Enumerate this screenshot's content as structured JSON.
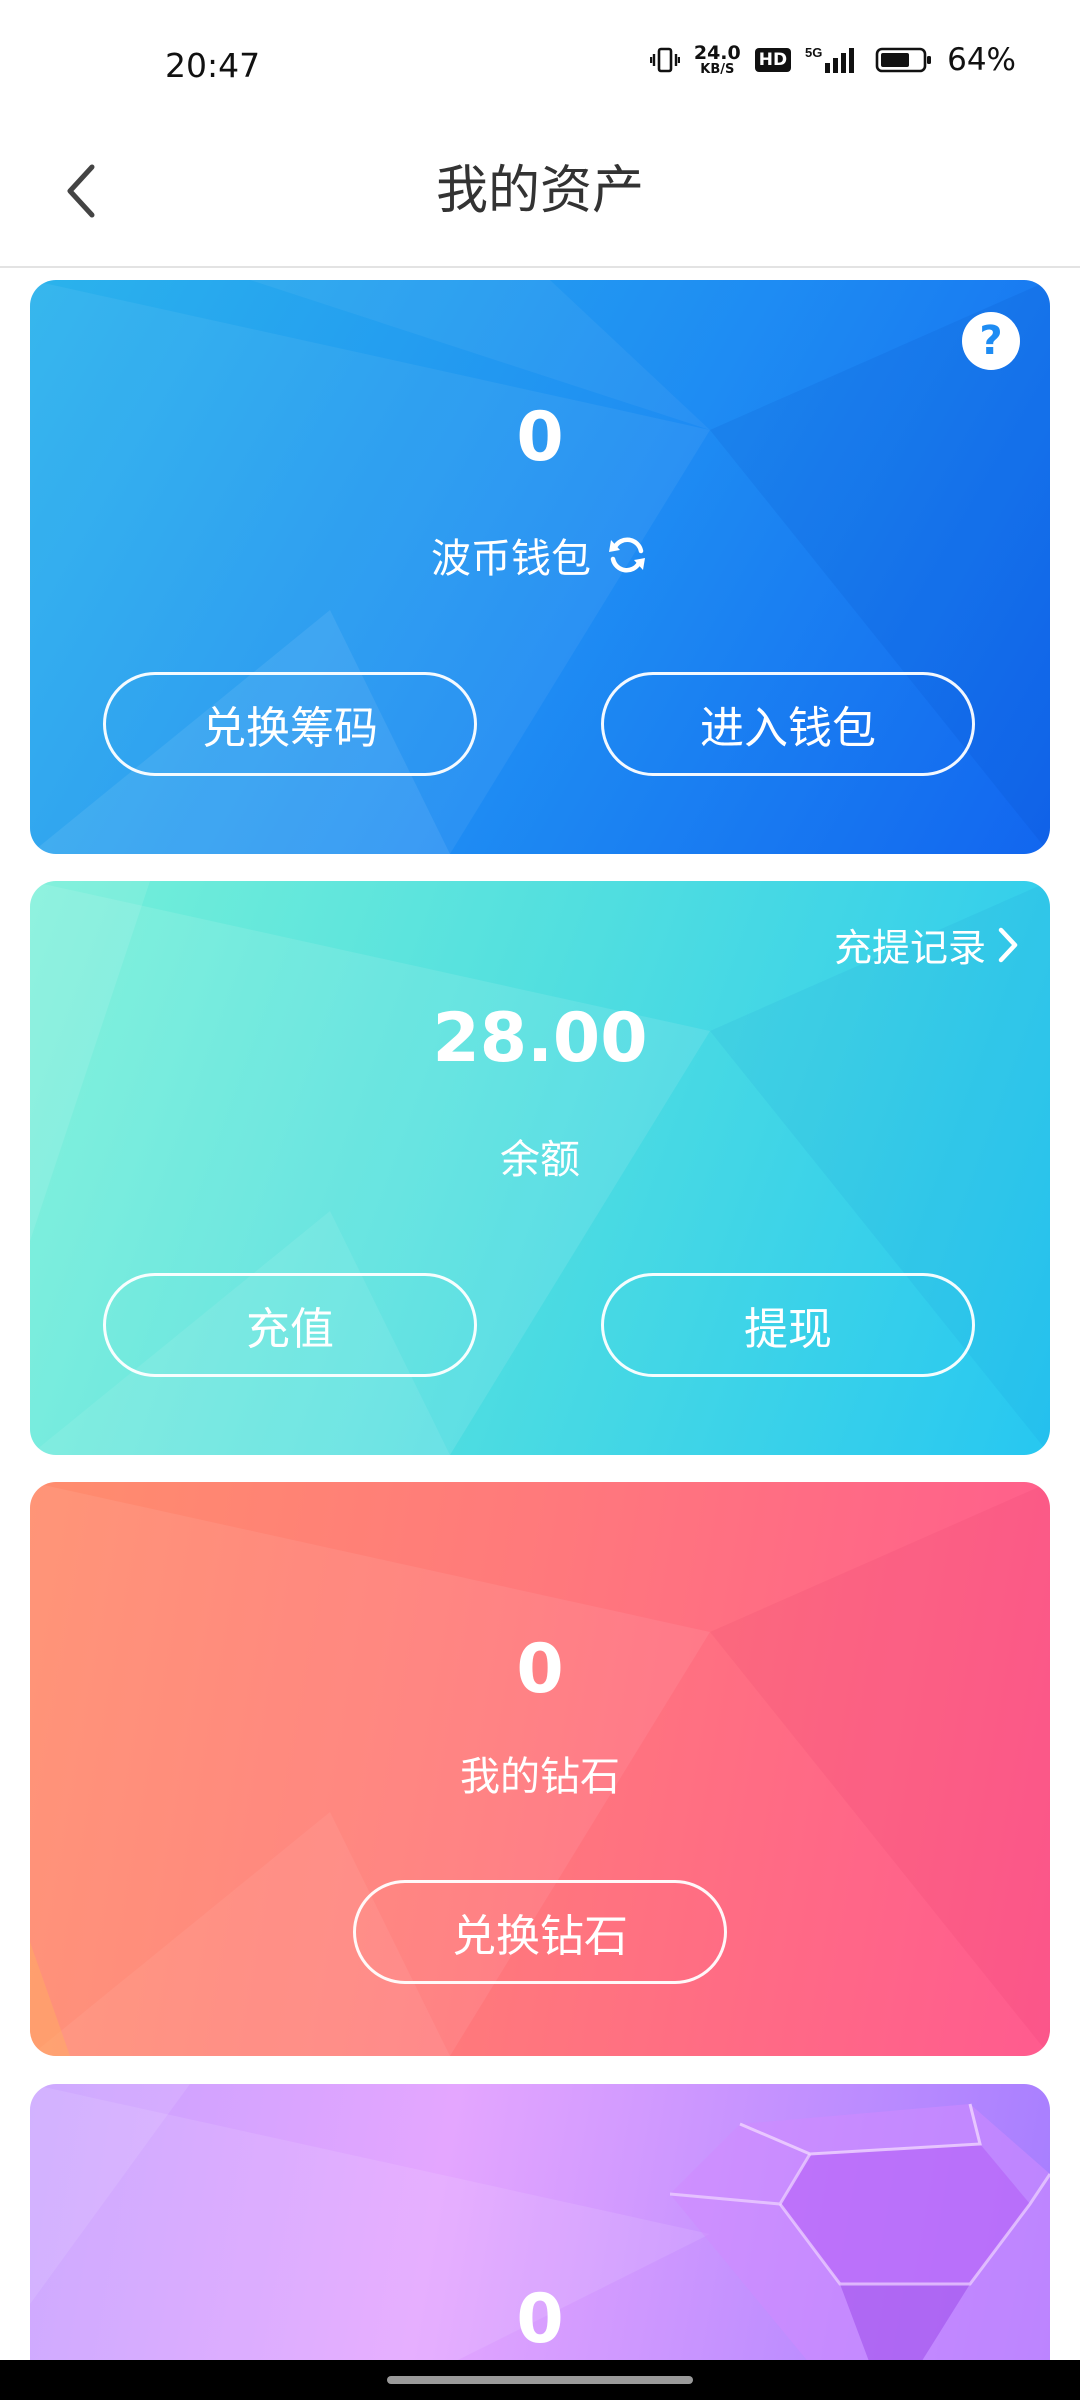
{
  "status_bar": {
    "time": "20:47",
    "net_speed_value": "24.0",
    "net_speed_unit": "KB/S",
    "hd_badge": "HD",
    "network_type": "5G",
    "battery_percent": "64%",
    "icons": [
      "vibrate-icon",
      "hd-icon",
      "signal-5g-icon",
      "battery-icon"
    ]
  },
  "navbar": {
    "back_icon": "chevron-left-icon",
    "title": "我的资产"
  },
  "cards": {
    "wallet": {
      "amount": "0",
      "label": "波币钱包",
      "help_symbol": "?",
      "buttons": [
        "兑换筹码",
        "进入钱包"
      ],
      "color": "#1E8CF3"
    },
    "balance": {
      "records_link": "充提记录",
      "amount": "28.00",
      "label": "余额",
      "buttons": [
        "充值",
        "提现"
      ],
      "color": "#3CD6E8"
    },
    "diamonds": {
      "amount": "0",
      "label": "我的钻石",
      "button": "兑换钻石",
      "color": "#FF6E85"
    },
    "gems": {
      "amount": "0",
      "color": "#C59BFF"
    }
  }
}
